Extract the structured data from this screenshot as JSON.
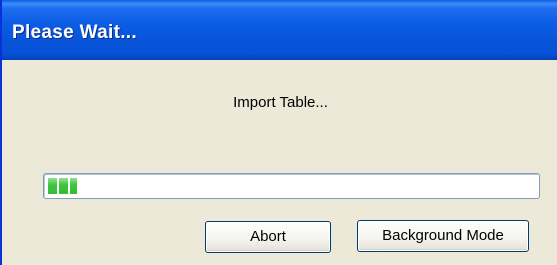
{
  "window": {
    "title": "Please Wait..."
  },
  "dialog": {
    "message": "Import Table..."
  },
  "progress": {
    "fraction": 0.06
  },
  "buttons": {
    "abort_label": "Abort",
    "background_label": "Background Mode"
  },
  "colors": {
    "titlebar": "#0A5DE4",
    "dialog_bg": "#ECE9D8",
    "progress_fill": "#3CC53C",
    "button_border": "#003C74"
  }
}
